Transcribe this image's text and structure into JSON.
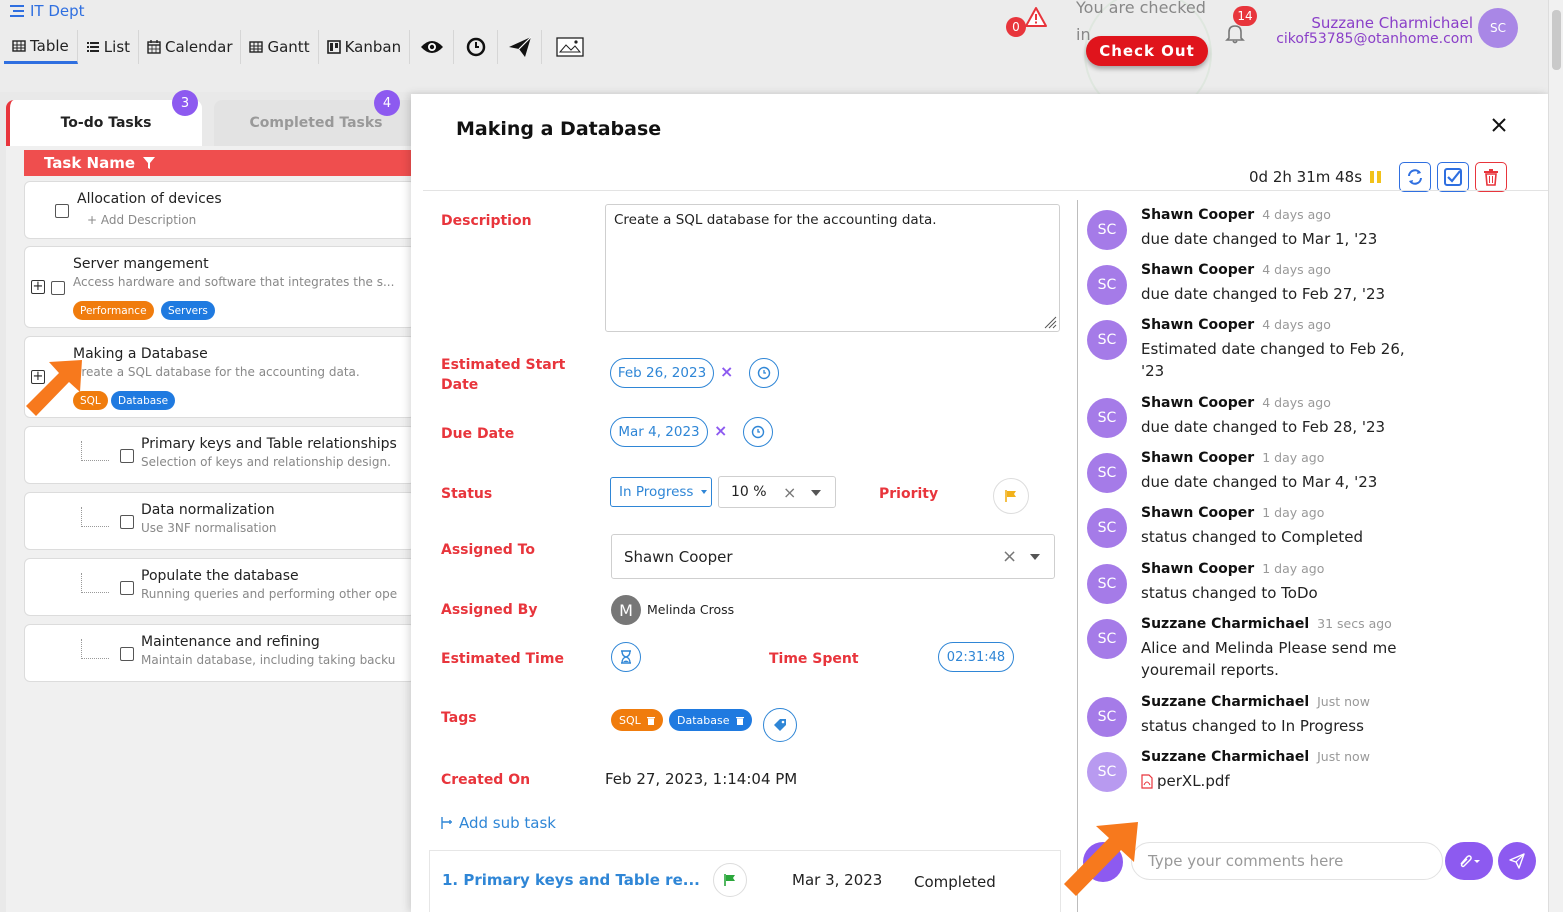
{
  "header": {
    "dept": "IT Dept",
    "view_tabs": [
      "Table",
      "List",
      "Calendar",
      "Gantt",
      "Kanban"
    ],
    "warning_count": "0",
    "checked_in_text_1": "You are checked",
    "checked_in_text_2": "in",
    "checkout_label": "Check Out",
    "notification_count": "14",
    "user_name": "Suzzane Charmichael",
    "user_email": "cikof53785@otanhome.com",
    "user_initials": "SC"
  },
  "task_list": {
    "tabs": [
      {
        "label": "To-do Tasks",
        "count": "3"
      },
      {
        "label": "Completed Tasks",
        "count": "4"
      }
    ],
    "column_header": "Task Name",
    "tasks": [
      {
        "title": "Allocation of devices",
        "desc": "+ Add Description"
      },
      {
        "title": "Server mangement",
        "desc": "Access hardware and software that integrates the s...",
        "tags": [
          "Performance",
          "Servers"
        ]
      },
      {
        "title": "Making a Database",
        "desc": "Create a SQL database for the accounting data.",
        "tags": [
          "SQL",
          "Database"
        ]
      },
      {
        "title": "Primary keys and Table relationships",
        "desc": "Selection of keys and relationship design."
      },
      {
        "title": "Data normalization",
        "desc": "Use 3NF normalisation"
      },
      {
        "title": "Populate the database",
        "desc": "Running queries and performing other ope"
      },
      {
        "title": "Maintenance and refining",
        "desc": "Maintain database, including taking backu"
      }
    ]
  },
  "modal": {
    "title": "Making a Database",
    "timer": "0d 2h 31m 48s",
    "labels": {
      "description": "Description",
      "est_start": "Estimated Start",
      "est_start_2": "Date",
      "due": "Due Date",
      "status": "Status",
      "priority": "Priority",
      "assigned_to": "Assigned To",
      "assigned_by": "Assigned By",
      "est_time": "Estimated Time",
      "time_spent": "Time Spent",
      "tags": "Tags",
      "created_on": "Created On"
    },
    "description": "Create a SQL database for the accounting data.",
    "est_start_date": "Feb 26, 2023",
    "due_date": "Mar 4, 2023",
    "status": "In Progress",
    "progress": "10 %",
    "assigned_to": "Shawn Cooper",
    "assigned_by": "Melinda Cross",
    "assigned_by_initial": "M",
    "time_spent": "02:31:48",
    "tags": [
      "SQL",
      "Database"
    ],
    "created_on": "Feb 27, 2023, 1:14:04 PM",
    "add_subtask": "Add sub task",
    "subtask": {
      "name": "1. Primary keys and Table re...",
      "date": "Mar 3, 2023",
      "status": "Completed"
    },
    "comment_placeholder": "Type your comments here"
  },
  "activity": [
    {
      "initials": "SC",
      "name": "Shawn Cooper",
      "time": "4 days ago",
      "text": "due date changed to Mar 1, '23"
    },
    {
      "initials": "SC",
      "name": "Shawn Cooper",
      "time": "4 days ago",
      "text": "due date changed to Feb 27, '23"
    },
    {
      "initials": "SC",
      "name": "Shawn Cooper",
      "time": "4 days ago",
      "text": "Estimated date changed to Feb 26, '23"
    },
    {
      "initials": "SC",
      "name": "Shawn Cooper",
      "time": "4 days ago",
      "text": "due date changed to Feb 28, '23"
    },
    {
      "initials": "SC",
      "name": "Shawn Cooper",
      "time": "1 day ago",
      "text": "due date changed to Mar 4, '23"
    },
    {
      "initials": "SC",
      "name": "Shawn Cooper",
      "time": "1 day ago",
      "text": "status changed to Completed"
    },
    {
      "initials": "SC",
      "name": "Shawn Cooper",
      "time": "1 day ago",
      "text": "status changed to ToDo"
    },
    {
      "initials": "SC",
      "name": "Suzzane Charmichael",
      "time": "31 secs ago",
      "text": "Alice and Melinda Please send me youremail reports."
    },
    {
      "initials": "SC",
      "name": "Suzzane Charmichael",
      "time": "Just now",
      "text": "status changed to In Progress"
    },
    {
      "initials": "SC",
      "name": "Suzzane Charmichael",
      "time": "Just now",
      "text": "perXL.pdf"
    }
  ],
  "colors": {
    "accent": "#8d5af0",
    "danger": "#e8353c",
    "link": "#2f86d6",
    "tag_orange": "#f07c0d",
    "tag_blue": "#1f7ae0"
  },
  "icons": [
    "menu-icon",
    "table-icon",
    "list-icon",
    "calendar-icon",
    "gantt-icon",
    "kanban-icon",
    "eye-icon",
    "clock-icon",
    "send-icon",
    "image-icon",
    "warning-icon",
    "bell-icon",
    "filter-icon",
    "close-icon",
    "refresh-icon",
    "check-icon",
    "trash-icon",
    "flag-icon",
    "hourglass-icon",
    "tag-icon",
    "attach-icon",
    "pdf-icon"
  ]
}
